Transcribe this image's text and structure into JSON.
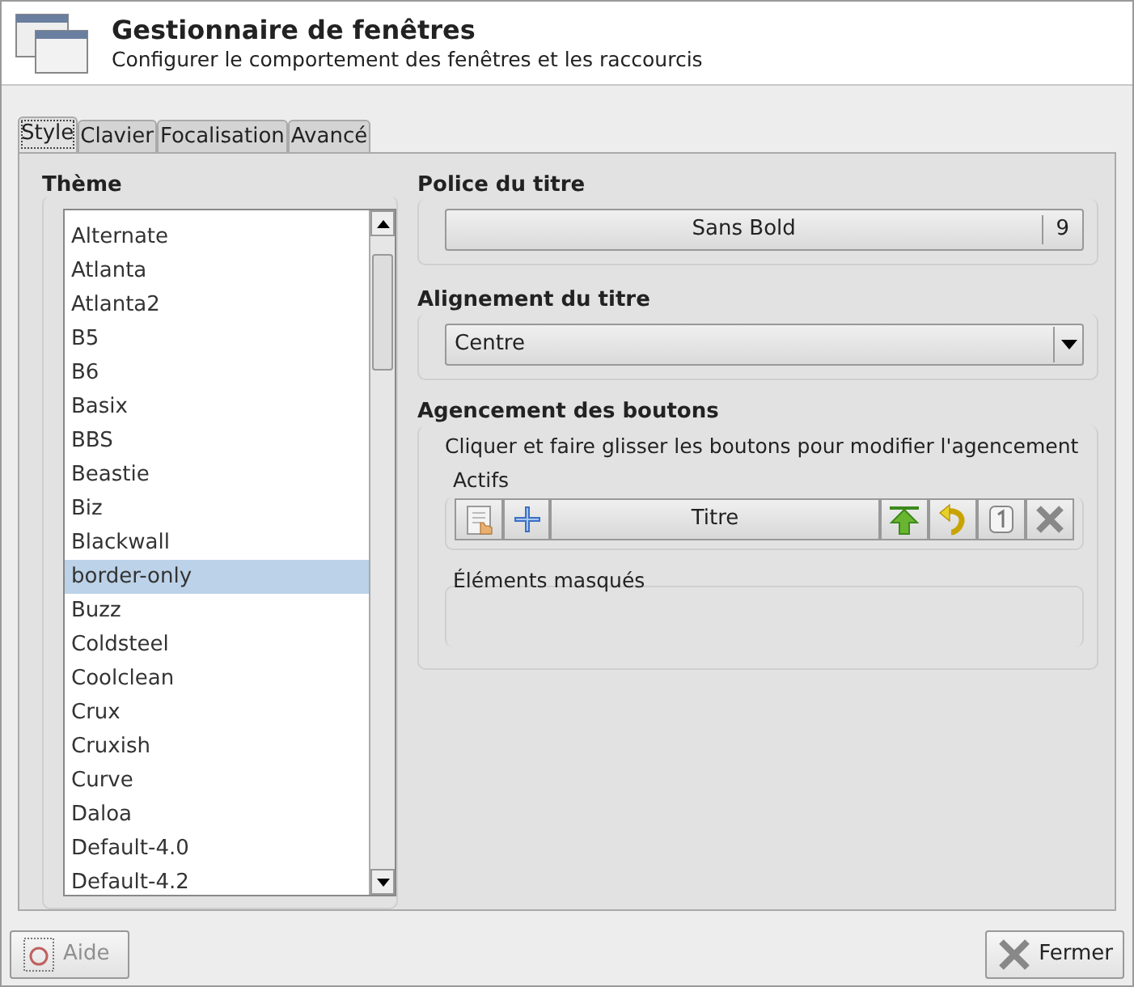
{
  "header": {
    "title": "Gestionnaire de fenêtres",
    "subtitle": "Configurer le comportement des fenêtres et les raccourcis"
  },
  "tabs": [
    {
      "label": "Style",
      "selected": true
    },
    {
      "label": "Clavier",
      "selected": false
    },
    {
      "label": "Focalisation",
      "selected": false
    },
    {
      "label": "Avancé",
      "selected": false
    }
  ],
  "theme": {
    "label": "Thème",
    "items": [
      {
        "label": "Alternate",
        "selected": false
      },
      {
        "label": "Atlanta",
        "selected": false
      },
      {
        "label": "Atlanta2",
        "selected": false
      },
      {
        "label": "B5",
        "selected": false
      },
      {
        "label": "B6",
        "selected": false
      },
      {
        "label": "Basix",
        "selected": false
      },
      {
        "label": "BBS",
        "selected": false
      },
      {
        "label": "Beastie",
        "selected": false
      },
      {
        "label": "Biz",
        "selected": false
      },
      {
        "label": "Blackwall",
        "selected": false
      },
      {
        "label": "border-only",
        "selected": true
      },
      {
        "label": "Buzz",
        "selected": false
      },
      {
        "label": "Coldsteel",
        "selected": false
      },
      {
        "label": "Coolclean",
        "selected": false
      },
      {
        "label": "Crux",
        "selected": false
      },
      {
        "label": "Cruxish",
        "selected": false
      },
      {
        "label": "Curve",
        "selected": false
      },
      {
        "label": "Daloa",
        "selected": false
      },
      {
        "label": "Default-4.0",
        "selected": false
      },
      {
        "label": "Default-4.2",
        "selected": false
      }
    ]
  },
  "title_font": {
    "label": "Police du titre",
    "font": "Sans Bold",
    "size": "9"
  },
  "title_alignment": {
    "label": "Alignement du titre",
    "value": "Centre"
  },
  "button_layout": {
    "label": "Agencement des boutons",
    "hint": "Cliquer et faire glisser les boutons pour modifier l'agencement",
    "active": {
      "label": "Actifs",
      "items": [
        {
          "kind": "menu"
        },
        {
          "kind": "stick"
        },
        {
          "kind": "title",
          "label": "Titre"
        },
        {
          "kind": "shade"
        },
        {
          "kind": "hide"
        },
        {
          "kind": "maximize"
        },
        {
          "kind": "close"
        }
      ]
    },
    "hidden": {
      "label": "Éléments masqués"
    }
  },
  "buttons": [
    {
      "label": "Aide",
      "disabled": true,
      "kind": "help"
    },
    {
      "label": "Fermer",
      "disabled": false,
      "kind": "close"
    }
  ]
}
